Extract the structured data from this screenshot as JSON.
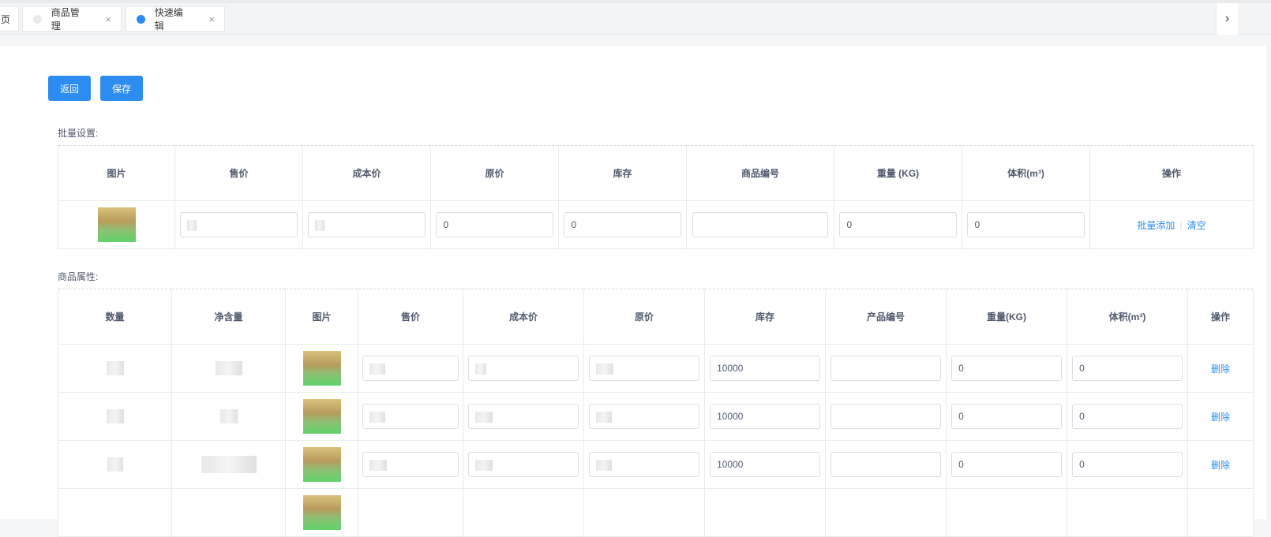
{
  "tabs": [
    {
      "label": "页"
    },
    {
      "label": "商品管理",
      "close": "×"
    },
    {
      "label": "快速编辑",
      "close": "×"
    }
  ],
  "tab_arrow": "›",
  "buttons": {
    "back": "返回",
    "save": "保存"
  },
  "batch": {
    "label": "批量设置:",
    "headers": [
      "图片",
      "售价",
      "成本价",
      "原价",
      "库存",
      "商品编号",
      "重量 (KG)",
      "体积(m³)",
      "操作"
    ],
    "row": {
      "original": "0",
      "stock": "0",
      "code": "",
      "weight": "0",
      "volume": "0"
    },
    "actions": {
      "add": "批量添加",
      "clear": "清空"
    }
  },
  "attrs": {
    "label": "商品属性:",
    "headers": [
      "数量",
      "净含量",
      "图片",
      "售价",
      "成本价",
      "原价",
      "库存",
      "产品编号",
      "重量(KG)",
      "体积(m³)",
      "操作"
    ],
    "rows": [
      {
        "stock": "10000",
        "code": "",
        "weight": "0",
        "volume": "0",
        "action": "删除"
      },
      {
        "stock": "10000",
        "code": "",
        "weight": "0",
        "volume": "0",
        "action": "删除"
      },
      {
        "stock": "10000",
        "code": "",
        "weight": "0",
        "volume": "0",
        "action": "删除"
      }
    ]
  },
  "colors": {
    "primary": "#2d8cf0",
    "border": "#e8eaec"
  }
}
